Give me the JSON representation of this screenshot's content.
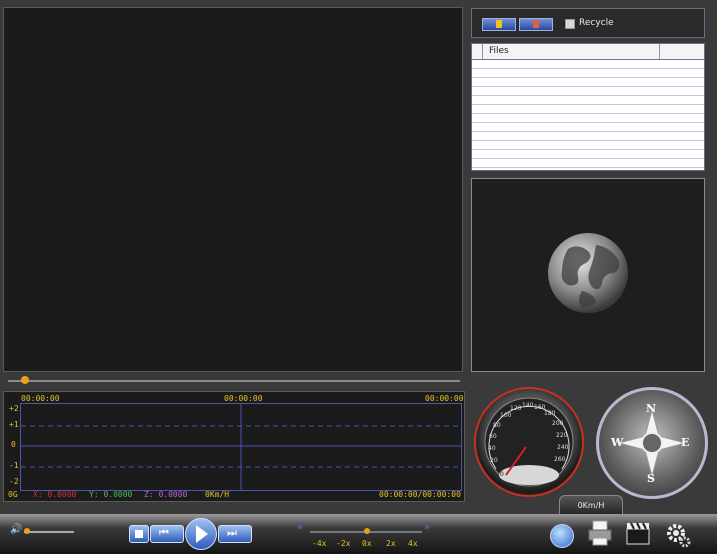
{
  "video": {},
  "gsensor": {
    "time_start": "00:00:00",
    "time_mid": "00:00:00",
    "time_end": "00:00:00",
    "y_labels": [
      "+2",
      "+1",
      "0",
      "-1",
      "-2"
    ],
    "unit_label": "0G",
    "x_label": "X: 0.0000",
    "y_label": "Y: 0.0000",
    "z_label": "Z: 0.0000",
    "speed_readout": "0Km/H",
    "time_readout": "00:00:00/00:00:00",
    "colors": {
      "x": "#d83030",
      "y": "#48c048",
      "z": "#c060d0",
      "label": "#e8c020",
      "grid": "#4a56b0"
    }
  },
  "toolbar": {
    "recycle_label": "Recycle"
  },
  "files": {
    "header": "Files"
  },
  "speedometer": {
    "ticks": [
      "0",
      "20",
      "40",
      "60",
      "80",
      "100",
      "120",
      "140",
      "160",
      "180",
      "200",
      "220",
      "240",
      "260"
    ]
  },
  "compass": {
    "n": "N",
    "s": "S",
    "e": "E",
    "w": "W"
  },
  "speed_tab": {
    "label": "0Km/H"
  },
  "playback_speeds": [
    "-4x",
    "-2x",
    "0x",
    "2x",
    "4x"
  ]
}
